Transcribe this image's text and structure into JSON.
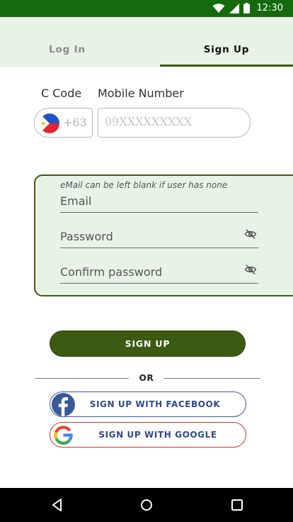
{
  "status_bar": {
    "time": "12:30",
    "icons": [
      "wifi-icon",
      "cellular-signal-icon",
      "battery-icon"
    ],
    "background": "#136b0c"
  },
  "tabs": [
    {
      "label": "Log In",
      "selected": false
    },
    {
      "label": "Sign Up",
      "selected": true
    }
  ],
  "phone": {
    "country_code_label": "C Code",
    "mobile_label": "Mobile Number",
    "country_code": "+63",
    "country_flag": "philippines-flag-icon",
    "mobile_placeholder": "09XXXXXXXXX",
    "mobile_value": ""
  },
  "credentials": {
    "hint": "eMail can be left blank if user has none",
    "email_placeholder": "Email",
    "password_placeholder": "Password",
    "confirm_placeholder": "Confirm password",
    "visibility_icon": "eye-off-icon"
  },
  "actions": {
    "signup_label": "SIGN UP",
    "or_label": "OR",
    "facebook_label": "SIGN UP WITH FACEBOOK",
    "google_label": "SIGN UP WITH GOOGLE"
  },
  "colors": {
    "accent": "#3d5a12",
    "card_bg": "#e8f3e8",
    "facebook": "#3b5998",
    "google_border": "#c0392b"
  },
  "nav_bar": {
    "buttons": [
      "back-icon",
      "home-icon",
      "recents-icon"
    ]
  }
}
